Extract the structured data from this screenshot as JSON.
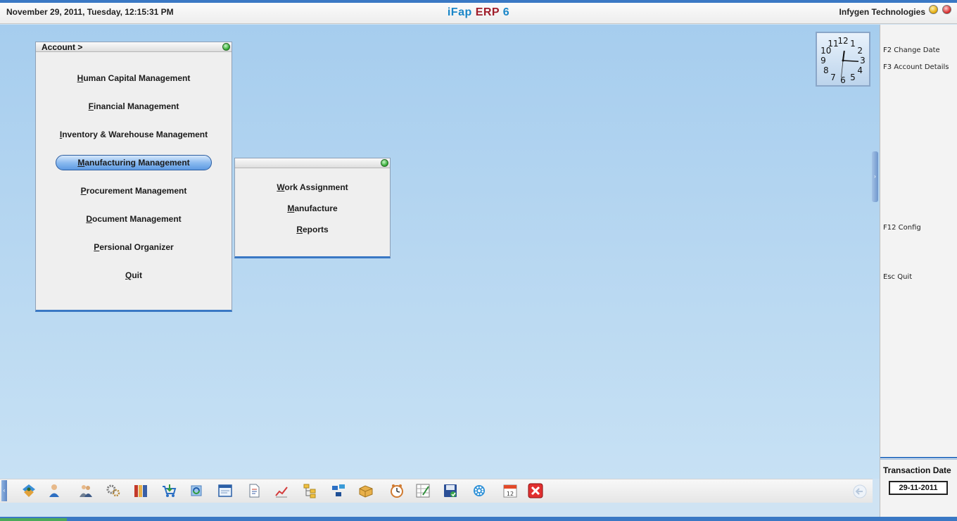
{
  "header": {
    "datetime": "November  29, 2011, Tuesday, 12:15:31 PM",
    "title_part1": "iFap",
    "title_part2": "ERP",
    "title_part3": "6",
    "company": "Infygen Technologies"
  },
  "main_menu": {
    "title": "Account >",
    "items": [
      "Human Capital Management",
      "Financial Management",
      "Inventory & Warehouse Management",
      "Manufacturing Management",
      "Procurement Management",
      "Document Management",
      "Persional Organizer",
      "Quit"
    ],
    "active_item": "Manufacturing Management"
  },
  "sub_menu": {
    "items": [
      "Work Assignment",
      "Manufacture",
      "Reports"
    ]
  },
  "right_panel": {
    "f2": "F2 Change Date",
    "f3": "F3 Account Details",
    "f12": "F12 Config",
    "esc": "Esc Quit",
    "transaction_label": "Transaction Date",
    "transaction_date": "29-11-2011"
  },
  "clock": {
    "hour": 12,
    "minute": 15,
    "second": 31
  },
  "taskbar": {
    "icons": [
      "organization-icon",
      "user-icon",
      "people-icon",
      "gears-icon",
      "books-icon",
      "cart-icon",
      "refresh-icon",
      "window-icon",
      "document-icon",
      "chart-icon",
      "tree-icon",
      "network-icon",
      "folder-icon",
      "clock-tool-icon",
      "checklist-icon",
      "save-icon",
      "settings-icon",
      "calendar-icon",
      "close-icon"
    ],
    "calendar_day": "12"
  },
  "colors": {
    "accent": "#3a78c4",
    "brand_blue": "#1a86c8",
    "brand_red": "#a01d2a",
    "desktop_top": "#a6cdee",
    "desktop_bottom": "#c7e1f4"
  }
}
